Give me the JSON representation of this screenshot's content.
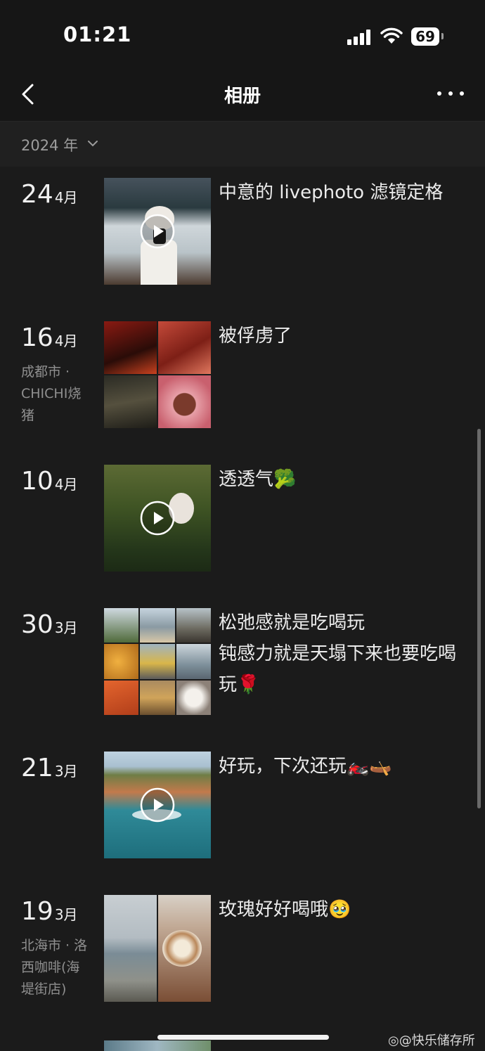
{
  "status_bar": {
    "time": "01:21",
    "battery": "69"
  },
  "nav": {
    "title": "相册"
  },
  "year_selector": {
    "label": "2024 年"
  },
  "entries": [
    {
      "day": "24",
      "month": "4月",
      "location": "",
      "caption": "中意的 livephoto 滤镜定格",
      "media": "video"
    },
    {
      "day": "16",
      "month": "4月",
      "location": "成都市 · CHICHI烧猪",
      "caption": "被俘虏了",
      "media": "grid4"
    },
    {
      "day": "10",
      "month": "4月",
      "location": "",
      "caption": "透透气🥦",
      "media": "video"
    },
    {
      "day": "30",
      "month": "3月",
      "location": "",
      "caption": "松弛感就是吃喝玩\n钝感力就是天塌下来也要吃喝玩🌹",
      "media": "grid9"
    },
    {
      "day": "21",
      "month": "3月",
      "location": "",
      "caption": "好玩，下次还玩🏍️🛶",
      "media": "video"
    },
    {
      "day": "19",
      "month": "3月",
      "location": "北海市 · 洛西咖啡(海堤街店)",
      "caption": "玫瑰好好喝哦🥹",
      "media": "grid2"
    }
  ],
  "watermark": "@快乐储存所",
  "colors": {
    "background": "#1b1b1b",
    "header": "#161616",
    "text": "#ececec",
    "muted": "#8f8f8f"
  }
}
